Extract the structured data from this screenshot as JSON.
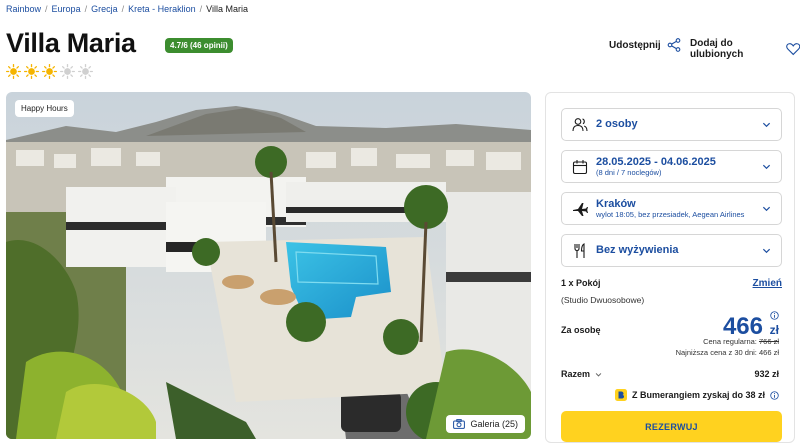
{
  "breadcrumb": {
    "items": [
      "Rainbow",
      "Europa",
      "Grecja",
      "Kreta - Heraklion"
    ],
    "current": "Villa Maria"
  },
  "hotel": {
    "name": "Villa Maria",
    "rating_text": "4.7/6 (46 opinii)",
    "suns": {
      "filled": 3,
      "total": 5
    }
  },
  "actions": {
    "share_label": "Udostępnij",
    "favorite_label": "Dodaj do ulubionych"
  },
  "hero": {
    "tag": "Happy Hours",
    "gallery_label": "Galeria (25)"
  },
  "booking": {
    "travellers": {
      "main": "2 osoby",
      "icon": "people-icon"
    },
    "dates": {
      "main": "28.05.2025 - 04.06.2025",
      "sub": "(8 dni / 7 noclegów)",
      "icon": "calendar-icon"
    },
    "departure": {
      "main": "Kraków",
      "sub": "wylot 18:05, bez przesiadek, Aegean Airlines",
      "icon": "plane-icon"
    },
    "board": {
      "main": "Bez wyżywienia",
      "icon": "cutlery-icon"
    },
    "room_count": "1 x Pokój",
    "change_label": "Zmień",
    "room_type": "(Studio Dwuosobowe)",
    "per_person_label": "Za osobę",
    "price_value": "466",
    "price_currency": "zł",
    "regular_label": "Cena regularna:",
    "regular_price": "766 zł",
    "lowest_text": "Najniższa cena z 30 dni: 466 zł",
    "total_label": "Razem",
    "total_value": "932 zł",
    "boomerang_text": "Z Bumerangiem zyskaj do 38 zł",
    "reserve_label": "REZERWUJ"
  },
  "colors": {
    "accent_blue": "#1c4ea0",
    "rating_green": "#3c8d2f",
    "sun_filled": "#f5b400",
    "sun_empty": "#d0d0d0",
    "reserve_yellow": "#ffd21f"
  }
}
